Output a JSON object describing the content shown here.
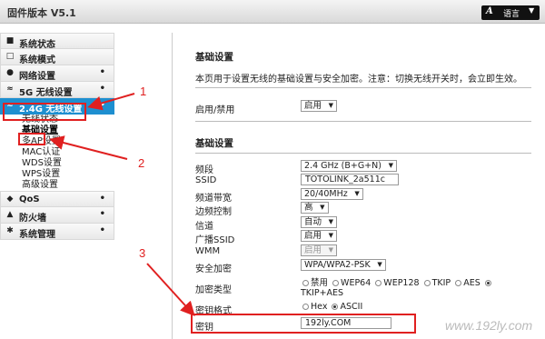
{
  "header": {
    "firmware": "固件版本 V5.1",
    "lang_glyph": "A",
    "lang_label": "语言",
    "lang_caret": "▼"
  },
  "sidebar": {
    "items": [
      {
        "icon": "■",
        "label": "系统状态"
      },
      {
        "icon": "□",
        "label": "系统模式"
      },
      {
        "icon": "●",
        "label": "网络设置",
        "dot": "•"
      },
      {
        "icon": "≈",
        "label": "5G 无线设置",
        "dot": "•"
      },
      {
        "icon": "≈",
        "label": "2.4G 无线设置",
        "dot": "•"
      }
    ],
    "sub_items": [
      "无线状态",
      "基础设置",
      "多AP设置",
      "MAC认证",
      "WDS设置",
      "WPS设置",
      "高级设置"
    ],
    "items_after": [
      {
        "icon": "◆",
        "label": "QoS",
        "dot": "•"
      },
      {
        "icon": "▲",
        "label": "防火墙",
        "dot": "•"
      },
      {
        "icon": "✱",
        "label": "系统管理",
        "dot": "•"
      }
    ]
  },
  "main": {
    "title": "基础设置",
    "description": "本页用于设置无线的基础设置与安全加密。注意：切换无线开关时，会立即生效。",
    "enable_label": "启用/禁用",
    "enable_value": "启用",
    "section": "基础设置",
    "fields": {
      "band": {
        "label": "频段",
        "value": "2.4 GHz (B+G+N)"
      },
      "ssid": {
        "label": "SSID",
        "value": "TOTOLINK_2a511c"
      },
      "bandwidth": {
        "label": "频道带宽",
        "value": "20/40MHz"
      },
      "sideband": {
        "label": "边频控制",
        "value": "高"
      },
      "channel": {
        "label": "信道",
        "value": "自动"
      },
      "broadcast": {
        "label": "广播SSID",
        "value": "启用"
      },
      "wmm": {
        "label": "WMM",
        "value": "启用"
      },
      "security": {
        "label": "安全加密",
        "value": "WPA/WPA2-PSK"
      },
      "encryption": {
        "label": "加密类型",
        "options": [
          "禁用",
          "WEP64",
          "WEP128",
          "TKIP",
          "AES",
          "TKIP+AES"
        ],
        "selected": "AES"
      },
      "key_format": {
        "label": "密钥格式",
        "options": [
          "Hex",
          "ASCII"
        ],
        "selected": "ASCII"
      },
      "key": {
        "label": "密钥",
        "value": "192ly.COM"
      }
    }
  },
  "annotations": {
    "n1": "1",
    "n2": "2",
    "n3": "3",
    "watermark": "www.192ly.com"
  },
  "colors": {
    "active": "#1e8fd0",
    "annotation": "#e02020"
  }
}
